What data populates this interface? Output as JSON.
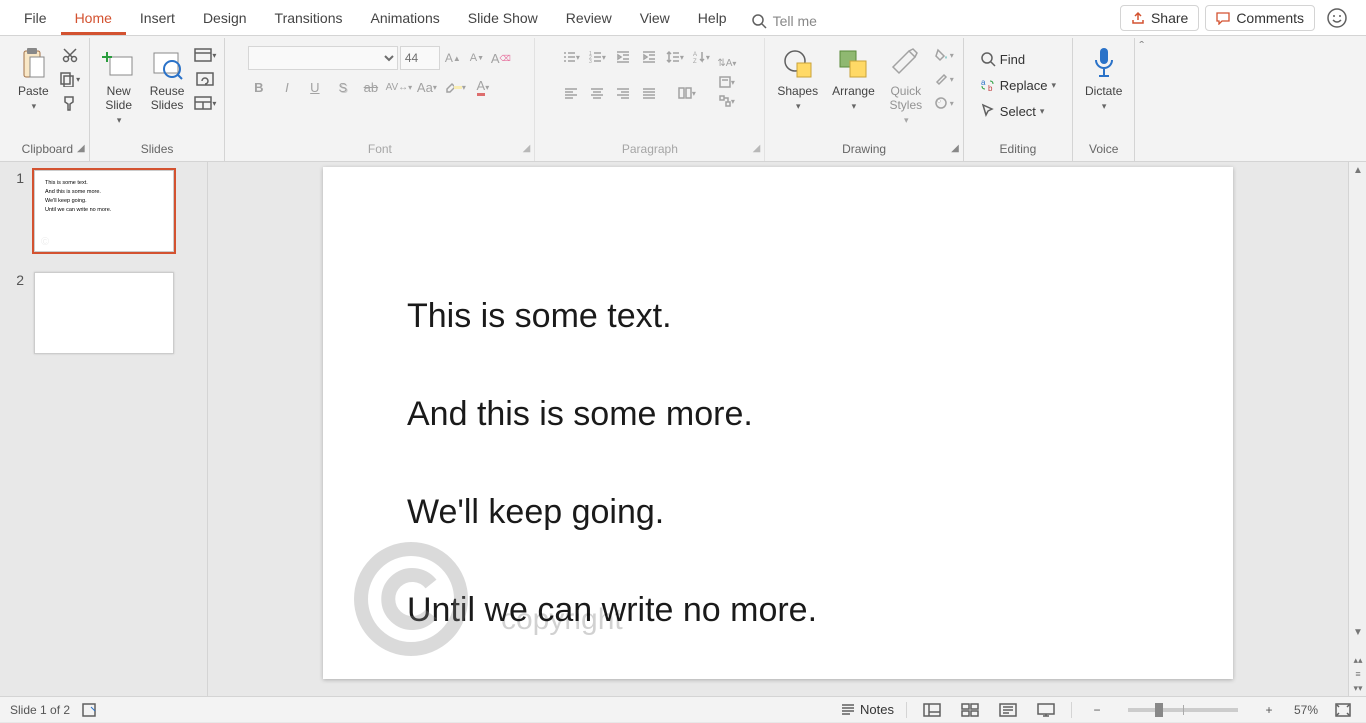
{
  "tabs": [
    "File",
    "Home",
    "Insert",
    "Design",
    "Transitions",
    "Animations",
    "Slide Show",
    "Review",
    "View",
    "Help"
  ],
  "active_tab": "Home",
  "tell_me": "Tell me",
  "share": "Share",
  "comments": "Comments",
  "ribbon": {
    "clipboard": {
      "label": "Clipboard",
      "paste": "Paste"
    },
    "slides": {
      "label": "Slides",
      "new_slide": "New\nSlide",
      "reuse": "Reuse\nSlides"
    },
    "font": {
      "label": "Font",
      "size": "44"
    },
    "paragraph": {
      "label": "Paragraph"
    },
    "drawing": {
      "label": "Drawing",
      "shapes": "Shapes",
      "arrange": "Arrange",
      "quick": "Quick\nStyles"
    },
    "editing": {
      "label": "Editing",
      "find": "Find",
      "replace": "Replace",
      "select": "Select"
    },
    "voice": {
      "label": "Voice",
      "dictate": "Dictate"
    }
  },
  "slide_content": {
    "lines": [
      "This is some text.",
      "And this is some more.",
      "We'll keep going.",
      "Until we can write no more."
    ],
    "watermark": "copyright"
  },
  "thumbnails": [
    {
      "num": "1",
      "lines": [
        "This is some text.",
        "And this is some more.",
        "We'll keep going.",
        "Until we can write no more."
      ],
      "active": true
    },
    {
      "num": "2",
      "lines": [],
      "active": false
    }
  ],
  "status": {
    "slide": "Slide 1 of 2",
    "notes": "Notes",
    "zoom": "57%"
  }
}
